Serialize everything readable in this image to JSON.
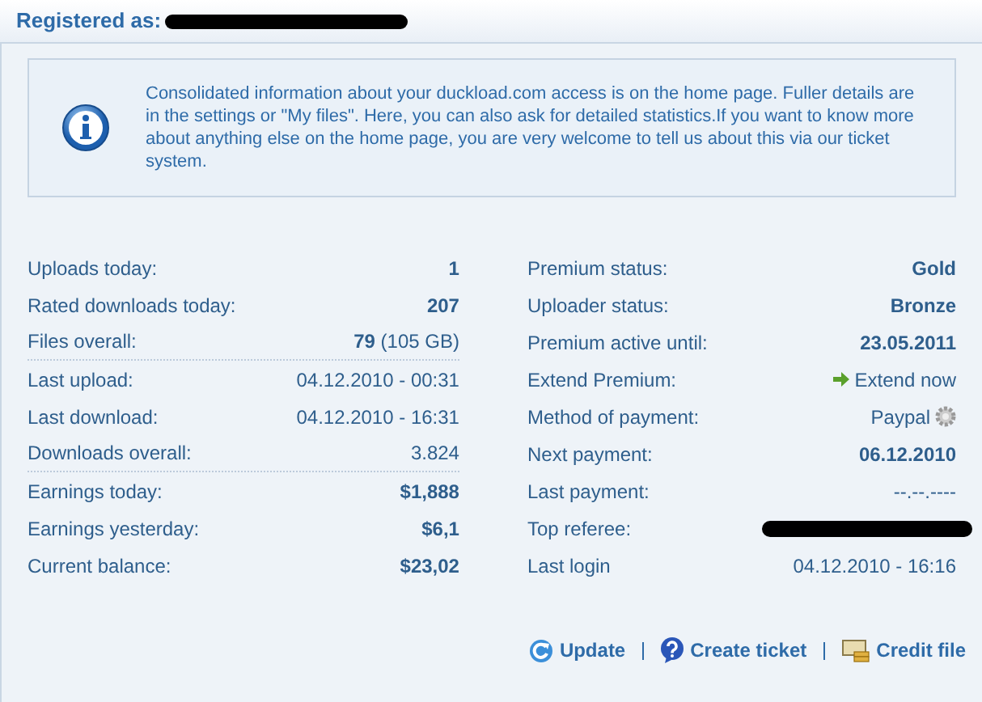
{
  "header": {
    "label": "Registered as:",
    "username_redacted": true
  },
  "info": {
    "text": "Consolidated information about your duckload.com access is on the home page. Fuller details are in the settings or \"My files\". Here, you can also ask for detailed statistics.If you want to know more about anything else on the home page, you are very welcome to tell us about this via our ticket system."
  },
  "stats": [
    {
      "label": "Uploads today:",
      "value": "1",
      "bold": true,
      "kind": "text",
      "divider_after": false
    },
    {
      "label": "Rated downloads today:",
      "value": "207",
      "bold": true,
      "kind": "text",
      "divider_after": false
    },
    {
      "label": "Files overall:",
      "value": "**79** (105 GB)",
      "bold": false,
      "kind": "text",
      "divider_after": true
    },
    {
      "label": "Last upload:",
      "value": "04.12.2010 - 00:31",
      "bold": false,
      "kind": "text",
      "divider_after": false
    },
    {
      "label": "Last download:",
      "value": "04.12.2010 - 16:31",
      "bold": false,
      "kind": "text",
      "divider_after": false
    },
    {
      "label": "Downloads overall:",
      "value": "3.824",
      "bold": false,
      "kind": "text",
      "divider_after": true
    },
    {
      "label": "Earnings today:",
      "value": "$1,888",
      "bold": true,
      "kind": "text",
      "divider_after": false
    },
    {
      "label": "Earnings yesterday:",
      "value": "$6,1",
      "bold": true,
      "kind": "text",
      "divider_after": false
    },
    {
      "label": "Current balance:",
      "value": "$23,02",
      "bold": true,
      "kind": "text",
      "divider_after": false
    }
  ],
  "status": [
    {
      "label": "Premium status:",
      "value": "Gold",
      "bold": true,
      "kind": "text"
    },
    {
      "label": "Uploader status:",
      "value": "Bronze",
      "bold": true,
      "kind": "text"
    },
    {
      "label": "Premium active until:",
      "value": "23.05.2011",
      "bold": true,
      "kind": "text"
    },
    {
      "label": "Extend Premium:",
      "value": "Extend now",
      "bold": false,
      "kind": "link"
    },
    {
      "label": "Method of payment:",
      "value": "Paypal",
      "bold": false,
      "kind": "settings"
    },
    {
      "label": "Next payment:",
      "value": "06.12.2010",
      "bold": true,
      "kind": "text"
    },
    {
      "label": "Last payment:",
      "value": "--.--.----",
      "bold": false,
      "kind": "text"
    },
    {
      "label": "Top referee:",
      "kind": "redacted"
    },
    {
      "label": "Last login",
      "value": "04.12.2010 - 16:16",
      "bold": false,
      "kind": "text"
    }
  ],
  "actions": [
    {
      "label": "Update",
      "kind": "refresh"
    },
    {
      "label": "Create ticket",
      "kind": "help"
    },
    {
      "label": "Credit file",
      "kind": "money"
    }
  ]
}
